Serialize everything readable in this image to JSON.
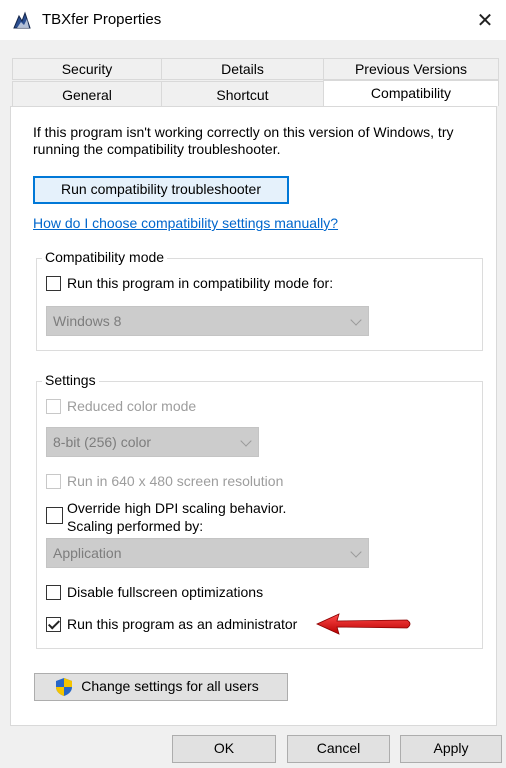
{
  "window": {
    "title": "TBXfer Properties",
    "close_glyph": "✕"
  },
  "tabs": {
    "row1": [
      "Security",
      "Details",
      "Previous Versions"
    ],
    "row2": [
      "General",
      "Shortcut",
      "Compatibility"
    ],
    "active": "Compatibility"
  },
  "intro_text": "If this program isn't working correctly on this version of Windows, try running the compatibility troubleshooter.",
  "troubleshooter_button": "Run compatibility troubleshooter",
  "manual_link": "How do I choose compatibility settings manually?",
  "compat_mode": {
    "legend": "Compatibility mode",
    "checkbox_label": "Run this program in compatibility mode for:",
    "checked": false,
    "select_value": "Windows 8"
  },
  "settings": {
    "legend": "Settings",
    "reduced_color_label": "Reduced color mode",
    "color_select_value": "8-bit (256) color",
    "res_640_label": "Run in 640 x 480 screen resolution",
    "dpi_label_line1": "Override high DPI scaling behavior.",
    "dpi_label_line2": "Scaling performed by:",
    "dpi_select_value": "Application",
    "fullscreen_label": "Disable fullscreen optimizations",
    "admin_label": "Run this program as an administrator",
    "admin_checked": true
  },
  "change_all_button": "Change settings for all users",
  "footer": {
    "ok": "OK",
    "cancel": "Cancel",
    "apply": "Apply"
  },
  "colors": {
    "link": "#0066cc",
    "focus_border": "#0078d7",
    "annotation_arrow": "#e01010"
  },
  "icons": {
    "app": "app-properties-icon",
    "close": "close-icon",
    "shield": "uac-shield-icon",
    "arrow": "red-arrow-annotation"
  }
}
